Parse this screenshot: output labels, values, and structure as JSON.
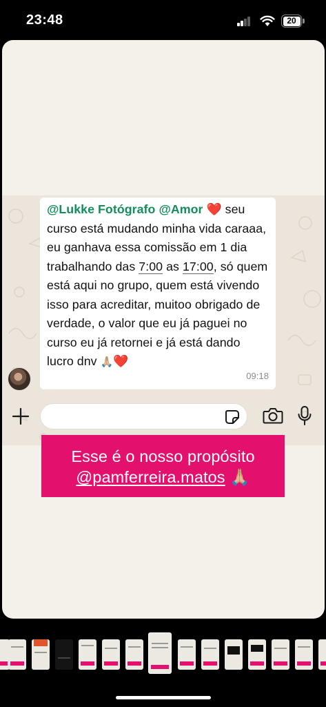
{
  "status_bar": {
    "time": "23:48",
    "battery": "20"
  },
  "message": {
    "mention_1": "@Lukke Fotógrafo",
    "mention_2": "@Amor",
    "heart": "❤️",
    "body_1": " seu curso está mudando minha vida caraaa, eu ganhava essa comissão em 1 dia trabalhando das ",
    "time_start": "7:00",
    "body_2": " as ",
    "time_end": "17:00",
    "body_3": ", só quem está aqui no grupo, quem está vivendo isso para acreditar, muitoo obrigado de verdade, o valor que eu já paguei no curso eu já retornei e já está dando lucro dnv ",
    "end_emoji_hands": "🙏🏼",
    "end_emoji_heart": "❤️",
    "timestamp": "09:18"
  },
  "composer": {
    "placeholder": ""
  },
  "caption": {
    "line_1": "Esse é o nosso propósito",
    "handle": "@pamferreira.matos",
    "emoji": "🙏🏼"
  },
  "icons": [
    "plus-icon",
    "sticker-icon",
    "camera-icon",
    "mic-icon",
    "wifi-icon",
    "signal-icon",
    "battery-icon"
  ],
  "colors": {
    "accent_pink": "#e4106e",
    "mention_green": "#138e5a"
  }
}
